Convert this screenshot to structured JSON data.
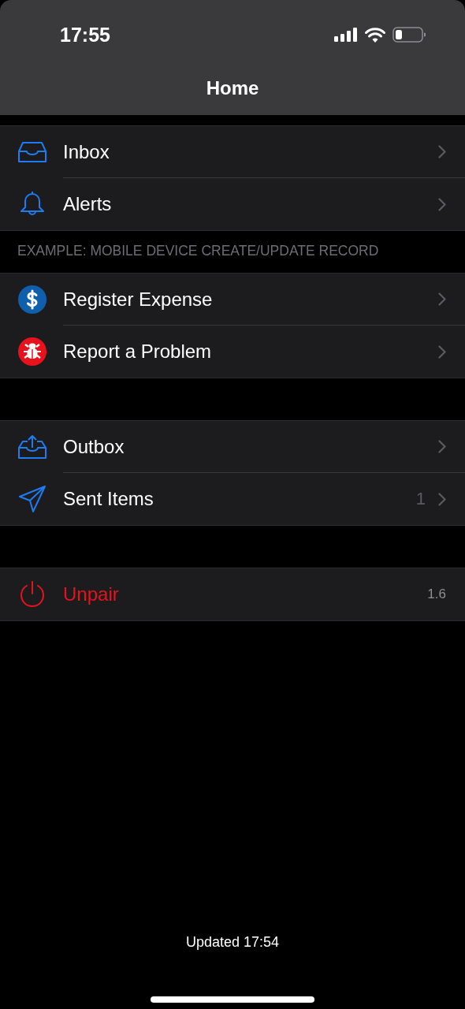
{
  "status_bar": {
    "time": "17:55"
  },
  "nav_bar": {
    "title": "Home"
  },
  "groups": [
    {
      "rows": [
        {
          "kind": "inbox",
          "label": "Inbox",
          "chevron": true,
          "destructive": false
        },
        {
          "kind": "bell",
          "label": "Alerts",
          "chevron": true,
          "destructive": false
        }
      ]
    },
    {
      "header": "EXAMPLE: MOBILE DEVICE CREATE/UPDATE RECORD",
      "rows": [
        {
          "kind": "dollar",
          "label": "Register Expense",
          "chevron": true,
          "destructive": false
        },
        {
          "kind": "bug",
          "label": "Report a Problem",
          "chevron": true,
          "destructive": false
        }
      ]
    },
    {
      "rows": [
        {
          "kind": "outbox",
          "label": "Outbox",
          "chevron": true,
          "destructive": false
        },
        {
          "kind": "send",
          "label": "Sent Items",
          "detail": "1",
          "chevron": true,
          "destructive": false
        }
      ]
    },
    {
      "rows": [
        {
          "kind": "power",
          "label": "Unpair",
          "detail": "1.6",
          "chevron": false,
          "destructive": true
        }
      ]
    }
  ],
  "footer": {
    "text": "Updated 17:54"
  }
}
